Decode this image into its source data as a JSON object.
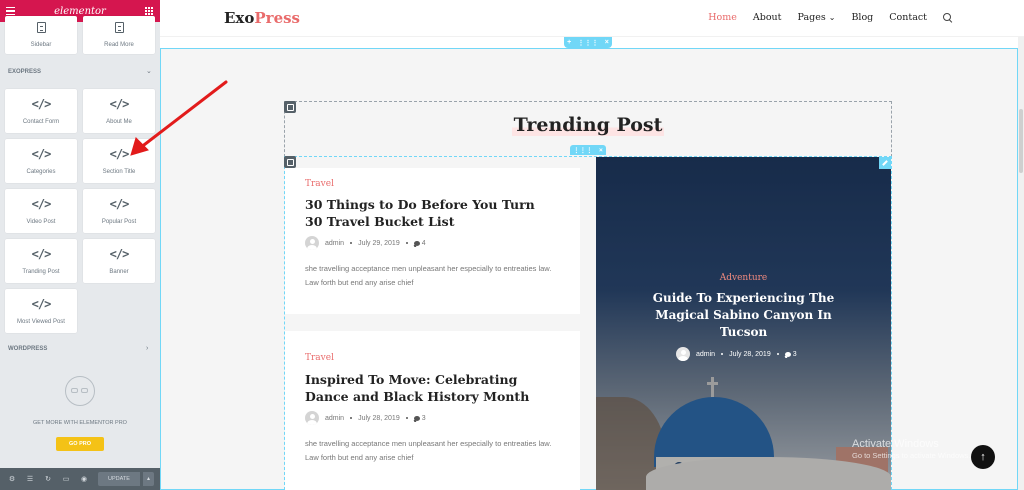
{
  "panel": {
    "logo": "elementor",
    "top_widgets": [
      {
        "label": "Sidebar",
        "icon": "sidebar-icon"
      },
      {
        "label": "Read More",
        "icon": "read-more-icon"
      }
    ],
    "category_exopress": "EXOPRESS",
    "widgets": [
      {
        "label": "Contact Form",
        "icon": "</>"
      },
      {
        "label": "About Me",
        "icon": "</>"
      },
      {
        "label": "Categories",
        "icon": "</>"
      },
      {
        "label": "Section Title",
        "icon": "</>"
      },
      {
        "label": "Video Post",
        "icon": "</>"
      },
      {
        "label": "Popular Post",
        "icon": "</>"
      },
      {
        "label": "Tranding Post",
        "icon": "</>"
      },
      {
        "label": "Banner",
        "icon": "</>"
      },
      {
        "label": "Most Viewed Post",
        "icon": "</>"
      }
    ],
    "category_wordpress": "WORDPRESS",
    "pro_text": "GET MORE WITH ELEMENTOR PRO",
    "go_pro": "GO PRO",
    "update": "UPDATE"
  },
  "site": {
    "brand_a": "Exo",
    "brand_b": "Press",
    "nav": [
      "Home",
      "About",
      "Pages",
      "Blog",
      "Contact"
    ],
    "section_title": "Trending Post",
    "posts": [
      {
        "category": "Travel",
        "title": "30 Things to Do Before You Turn 30 Travel Bucket List",
        "author": "admin",
        "date": "July 29, 2019",
        "comments": "4",
        "excerpt": "she travelling acceptance men unpleasant her especially to entreaties law. Law forth but end any arise chief"
      },
      {
        "category": "Travel",
        "title": "Inspired To Move: Celebrating Dance and Black History Month",
        "author": "admin",
        "date": "July 28, 2019",
        "comments": "3",
        "excerpt": "she travelling acceptance men unpleasant her especially to entreaties law. Law forth but end any arise chief"
      }
    ],
    "featured": {
      "category": "Adventure",
      "title": "Guide To Experiencing The Magical Sabino Canyon In Tucson",
      "author": "admin",
      "date": "July 28, 2019",
      "comments": "3"
    }
  },
  "watermark": {
    "title": "Activate Windows",
    "sub": "Go to Settings to activate Windows."
  },
  "colors": {
    "elementor_brand": "#d5164f",
    "accent": "#e96b6b",
    "editor_blue": "#71d7f7",
    "go_pro": "#f4c216",
    "annotation_arrow": "#e21b1b"
  }
}
